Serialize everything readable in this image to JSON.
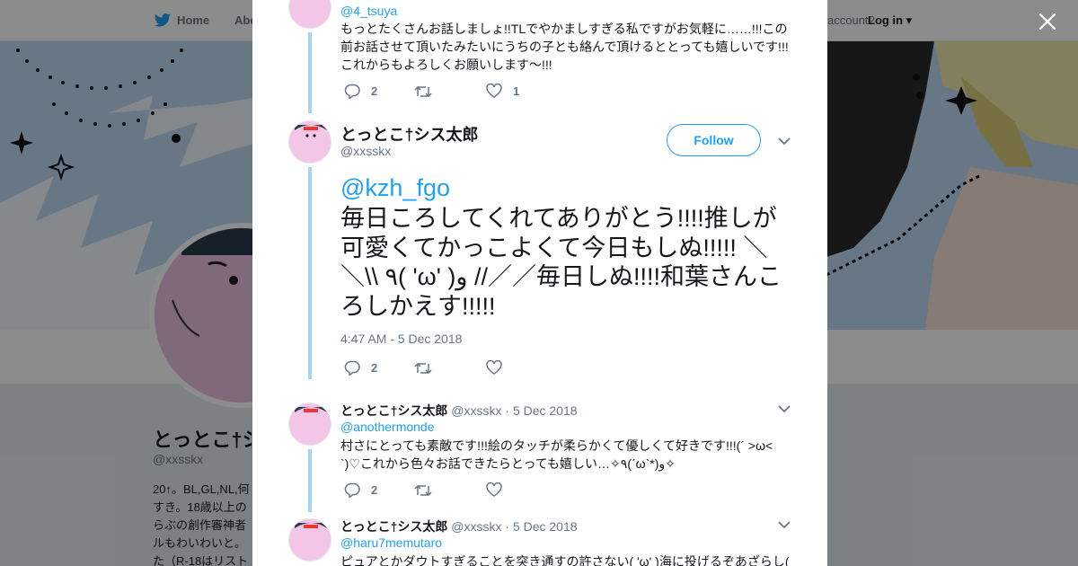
{
  "nav": {
    "home_label": "Home",
    "about_label": "Abo",
    "account_prompt": "account?",
    "login_label": "Log in"
  },
  "profile": {
    "name": "とっとこ†シ",
    "handle": "@xxsskx",
    "bio": "20↑。BL,GL,NL,何すき。18歳以上のらぶの創作審神者ルもわいわいと。た（R-18はリスト"
  },
  "tweets": {
    "prev": {
      "handle": "@4_tsuya",
      "text": "もっとたくさんお話しましょ!!TLでやかましすぎる私ですがお気軽に……!!!この前お話させて頂いたみたいにうちの子とも絡んで頂けるととっても嬉しいです!!!これからもよろしくお願いします〜!!!",
      "reply_count": "2",
      "like_count": "1"
    },
    "main": {
      "name": "とっとこ†シス太郎",
      "handle": "@xxsskx",
      "follow_label": "Follow",
      "mention": "@kzh_fgo",
      "text": "毎日ころしてくれてありがとう!!!!推しが可愛くてかっこよくて今日もしぬ!!!!! ＼＼\\\\ ٩( 'ω' )و //／／毎日しぬ!!!!和葉さんころしかえす!!!!!",
      "timestamp": "4:47 AM - 5 Dec 2018",
      "reply_count": "2"
    },
    "reply1": {
      "name": "とっとこ†シス太郎",
      "handle": "@xxsskx",
      "date": "5 Dec 2018",
      "mention": "@anothermonde",
      "text": "村さにとっても素敵です!!!絵のタッチが柔らかくて優しくて好きです!!!(´ >ω< `)♡これから色々お話できたらとっても嬉しい…✧٩(ˊωˋ*)و✧",
      "reply_count": "2"
    },
    "reply2": {
      "name": "とっとこ†シス太郎",
      "handle": "@xxsskx",
      "date": "5 Dec 2018",
      "mention": "@haru7memutaro",
      "text": "ピュアとかダウトすぎることを突き通すの許さない( 'ω' )海に投げるぞあざらし("
    }
  },
  "colors": {
    "accent": "#1da1f2",
    "thread": "#a3d4f3",
    "muted": "#657786"
  }
}
